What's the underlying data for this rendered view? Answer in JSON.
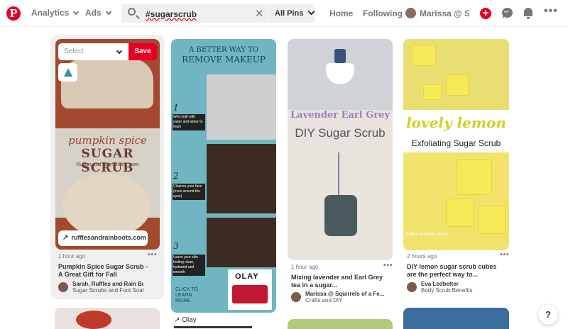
{
  "header": {
    "logo_letter": "P",
    "analytics": "Analytics",
    "ads": "Ads",
    "search_query": "#sugarscrub",
    "search_scope": "All Pins",
    "home": "Home",
    "following": "Following",
    "username": "Marissa @ S...",
    "plus": "+",
    "more": "•••",
    "accent": "#e60023"
  },
  "pins": [
    {
      "select_placeholder": "Select",
      "save_label": "Save",
      "link_label": "rufflesandrainboots.com",
      "image_text": [
        "pumpkin spice",
        "SUGAR SCRUB",
        "Ruffles and Rain Boots .com"
      ],
      "time": "1 hour ago",
      "title": "Pumpkin Spice Sugar Scrub - A Great Gift for Fall",
      "user": "Sarah, Ruffles and Rain Bo...",
      "board": "Sugar Scrubs and Foot Soak..."
    },
    {
      "image_text": [
        "A BETTER WAY TO",
        "REMOVE MAKEUP",
        "1",
        "Wet cloth with water and lather to foam",
        "2",
        "Cleanse your face (even around the eyes)",
        "3",
        "Leave your skin feeling clean, hydrated and smooth",
        "CLICK TO LEARN MORE",
        "OLAY"
      ],
      "source": "Olay"
    },
    {
      "image_text": [
        "Lavender Earl Grey",
        "DIY Sugar Scrub"
      ],
      "time": "1 hour ago",
      "title": "Mixing lavender and Earl Grey tea in a sugar...",
      "user": "Marissa @ Squirrels of a Fe...",
      "board": "Crafts and DIY"
    },
    {
      "image_text": [
        "lovely lemon",
        "Exfoliating Sugar Scrub",
        "Ruffles and Rain Boots"
      ],
      "time": "2 hours ago",
      "title": "DIY lemon sugar scrub cubes are the perfect way to...",
      "user": "Eva Ledbetter",
      "board": "Body Scrub Benefits"
    }
  ],
  "help": "?"
}
